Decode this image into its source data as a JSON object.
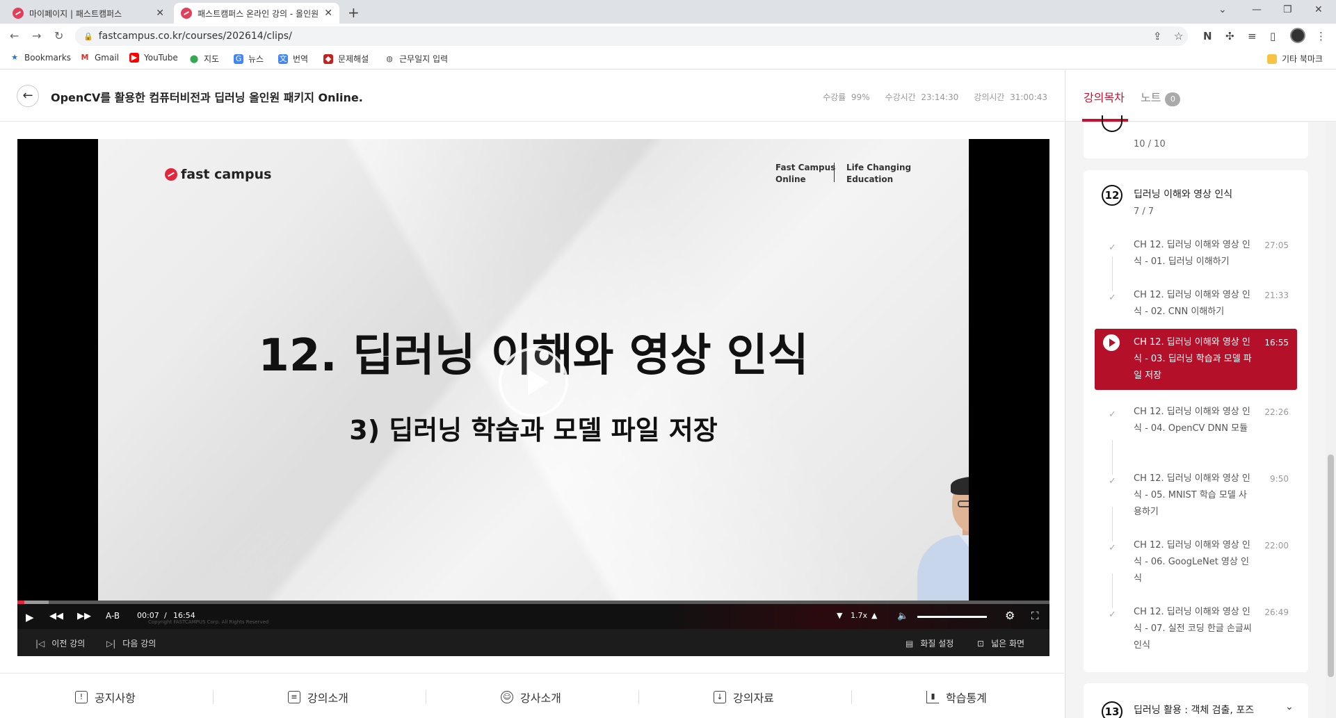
{
  "browser": {
    "tabs": [
      {
        "title": "마이페이지 | 패스트캠퍼스"
      },
      {
        "title": "패스트캠퍼스 온라인 강의 - 올인원"
      }
    ],
    "url": "fastcampus.co.kr/courses/202614/clips/",
    "bookmarks": [
      {
        "label": "Bookmarks",
        "icon": "star-icon"
      },
      {
        "label": "Gmail",
        "icon": "gmail-icon"
      },
      {
        "label": "YouTube",
        "icon": "youtube-icon"
      },
      {
        "label": "지도",
        "icon": "maps-icon"
      },
      {
        "label": "뉴스",
        "icon": "news-icon"
      },
      {
        "label": "번역",
        "icon": "translate-icon"
      },
      {
        "label": "문제해설",
        "icon": "bookmark-icon"
      },
      {
        "label": "근무일지 입력",
        "icon": "globe-icon"
      }
    ],
    "other_bookmarks": "기타 북마크"
  },
  "header": {
    "title": "OpenCV를 활용한 컴퓨터비전과 딥러닝 올인원 패키지 Online.",
    "stats": [
      {
        "label": "수강률",
        "value": "99%"
      },
      {
        "label": "수강시간",
        "value": "23:14:30"
      },
      {
        "label": "강의시간",
        "value": "31:00:43"
      }
    ]
  },
  "slide": {
    "brand": "fast campus",
    "tag1_line1": "Fast Campus",
    "tag1_line2": "Online",
    "tag2_line1": "Life Changing",
    "tag2_line2": "Education",
    "title": "12. 딥러닝 이해와 영상 인식",
    "subtitle": "3) 딥러닝 학습과 모델 파일 저장",
    "copyright": "Copyright FASTCAMPUS Corp. All Rights Reserved"
  },
  "player": {
    "progress": 0.007,
    "ab_label": "A-B",
    "current_time": "00:07",
    "separator": "/",
    "duration": "16:54",
    "speed": "1.7x",
    "volume": 1.0,
    "prev_label": "이전 강의",
    "next_label": "다음 강의",
    "quality_label": "화질 설정",
    "wide_label": "넓은 화면"
  },
  "bottom_menu": [
    {
      "label": "공지사항",
      "icon": "notice-icon"
    },
    {
      "label": "강의소개",
      "icon": "clipboard-icon"
    },
    {
      "label": "강사소개",
      "icon": "user-icon"
    },
    {
      "label": "강의자료",
      "icon": "download-doc-icon"
    },
    {
      "label": "학습통계",
      "icon": "stats-icon"
    }
  ],
  "sidebar": {
    "tabs": [
      {
        "label": "강의목차"
      },
      {
        "label": "노트",
        "badge": "0"
      }
    ],
    "prev_chapter_count": "10 / 10",
    "chapter": {
      "number": "12",
      "title": "딥러닝 이해와 영상 인식",
      "count": "7 / 7",
      "lessons": [
        {
          "title": "CH 12. 딥러닝 이해와 영상 인식 - 01. 딥러닝 이해하기",
          "duration": "27:05"
        },
        {
          "title": "CH 12. 딥러닝 이해와 영상 인식 - 02. CNN 이해하기",
          "duration": "21:33"
        },
        {
          "title": "CH 12. 딥러닝 이해와 영상 인식 - 03. 딥러닝 학습과 모델 파일 저장",
          "duration": "16:55"
        },
        {
          "title": "CH 12. 딥러닝 이해와 영상 인식 - 04. OpenCV DNN 모듈",
          "duration": "22:26"
        },
        {
          "title": "CH 12. 딥러닝 이해와 영상 인식 - 05. MNIST 학습 모델 사용하기",
          "duration": "9:50"
        },
        {
          "title": "CH 12. 딥러닝 이해와 영상 인식 - 06. GoogLeNet 영상 인식",
          "duration": "22:00"
        },
        {
          "title": "CH 12. 딥러닝 이해와 영상 인식 - 07. 실전 코딩 한글 손글씨 인식",
          "duration": "26:49"
        }
      ]
    },
    "next_chapter": {
      "number": "13",
      "title": "딥러닝 활용 : 객체 검출, 포즈"
    }
  },
  "colors": {
    "brand_red": "#c8102e",
    "active_lesson": "#b5102a",
    "progress": "#e2273d"
  }
}
